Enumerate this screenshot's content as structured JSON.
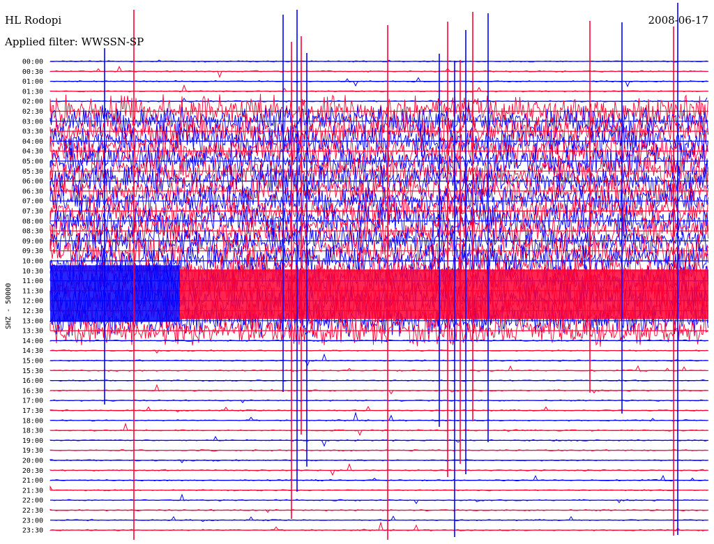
{
  "header": {
    "station": "HL Rodopi",
    "date": "2008-06-17",
    "filter_label": "Applied filter:",
    "filter_name": "WWSSN-SP"
  },
  "chart_data": {
    "type": "helicorder",
    "channel_label": "SHZ - 50000",
    "rows": [
      "00:00",
      "00:30",
      "01:00",
      "01:30",
      "02:00",
      "02:30",
      "03:00",
      "03:30",
      "04:00",
      "04:30",
      "05:00",
      "05:30",
      "06:00",
      "06:30",
      "07:00",
      "07:30",
      "08:00",
      "08:30",
      "09:00",
      "09:30",
      "10:00",
      "10:30",
      "11:00",
      "11:30",
      "12:00",
      "12:30",
      "13:00",
      "13:30",
      "14:00",
      "14:30",
      "15:00",
      "15:30",
      "16:00",
      "16:30",
      "17:00",
      "17:30",
      "18:00",
      "18:30",
      "19:00",
      "19:30",
      "20:00",
      "20:30",
      "21:00",
      "21:30",
      "22:00",
      "22:30",
      "23:00",
      "23:30"
    ],
    "trace_colors": [
      "#0000ff",
      "#ff0033"
    ],
    "background": "#ffffff",
    "noisy_rows": {
      "from": "02:30",
      "to": "13:30"
    },
    "saturated_rows": {
      "from": "10:30",
      "to": "12:30"
    }
  }
}
